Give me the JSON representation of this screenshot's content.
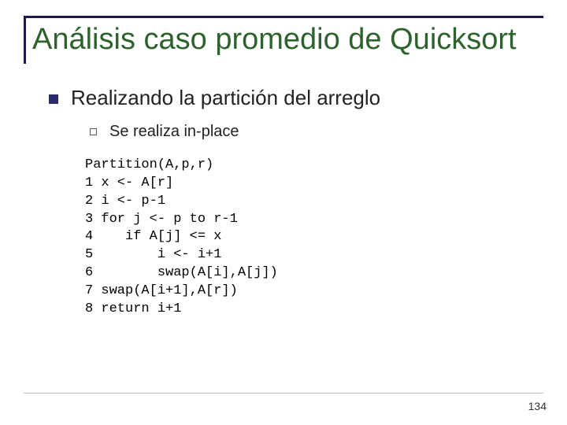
{
  "slide": {
    "title": "Análisis caso promedio de Quicksort",
    "heading": "Realizando la partición del arreglo",
    "subheading": "Se realiza in-place",
    "code": "Partition(A,p,r)\n1 x <- A[r]\n2 i <- p-1\n3 for j <- p to r-1\n4    if A[j] <= x\n5        i <- i+1\n6        swap(A[i],A[j])\n7 swap(A[i+1],A[r])\n8 return i+1",
    "page_number": "134"
  }
}
